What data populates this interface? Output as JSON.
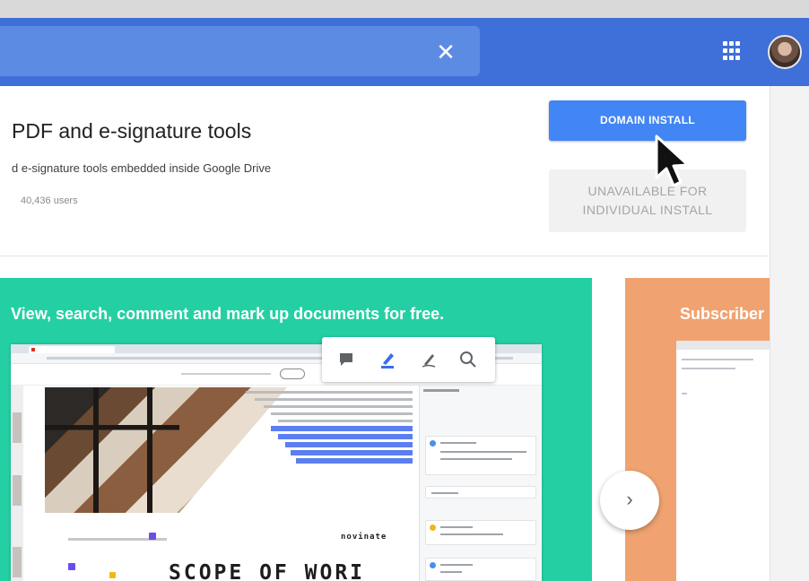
{
  "search": {
    "clear_icon": "close-icon",
    "clear_glyph": "✕"
  },
  "header": {
    "apps_icon": "apps-grid-icon",
    "avatar_icon": "user-avatar"
  },
  "listing": {
    "title": "PDF and e-signature tools",
    "subtitle": "d e-signature tools embedded inside Google Drive",
    "users": "40,436 users"
  },
  "buttons": {
    "domain_install": "DOMAIN INSTALL",
    "unavailable_line1": "UNAVAILABLE FOR",
    "unavailable_line2": "INDIVIDUAL INSTALL"
  },
  "carousel": {
    "slide1_caption": "View, search, comment and mark up documents for free.",
    "slide2_caption": "Subscriber",
    "next_glyph": "›",
    "next_icon": "chevron-right-icon"
  },
  "preview": {
    "scope_text": "SCOPE OF WORI",
    "brand_text": "novinate",
    "toolbar_icons": [
      "comment-icon",
      "highlight-icon",
      "draw-icon",
      "search-icon"
    ]
  },
  "colors": {
    "app_bar": "#3f6fd8",
    "primary_button": "#4285f4",
    "slide_green": "#24d0a3",
    "slide_orange": "#f0a370"
  }
}
